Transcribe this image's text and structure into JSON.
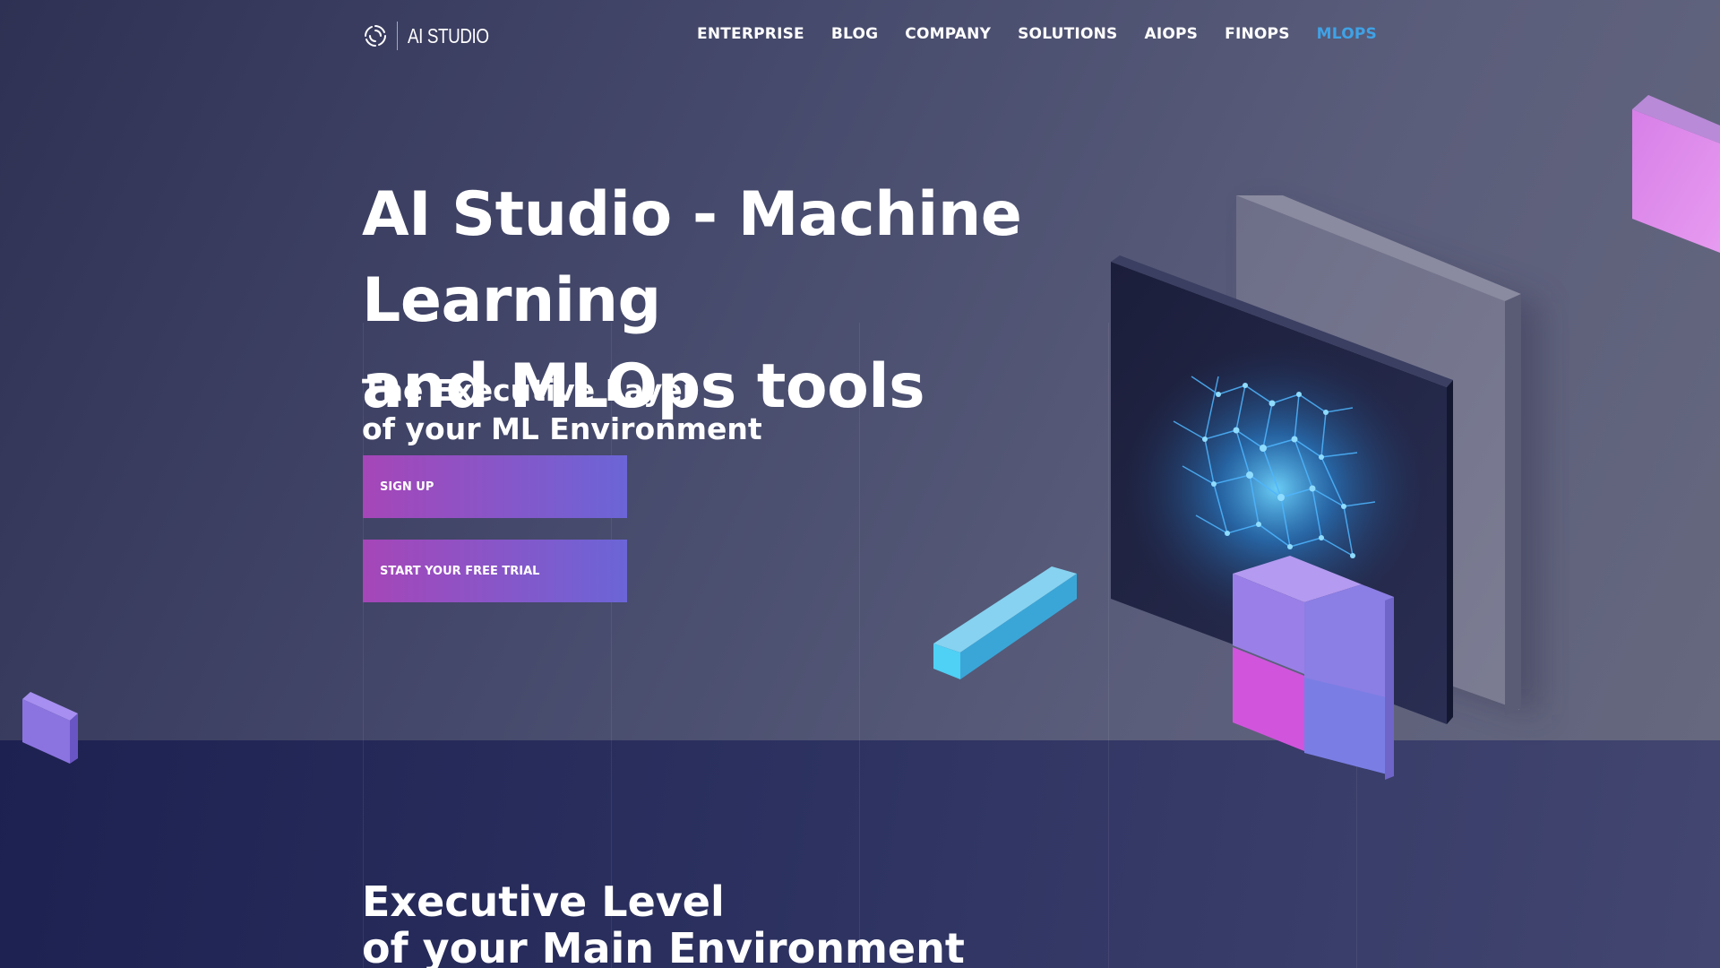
{
  "brand": {
    "name": "AI STUDIO",
    "logo_icon": "swirl-logo-icon"
  },
  "nav": {
    "items": [
      {
        "label": "ENTERPRISE",
        "active": false
      },
      {
        "label": "BLOG",
        "active": false
      },
      {
        "label": "COMPANY",
        "active": false
      },
      {
        "label": "SOLUTIONS",
        "active": false
      },
      {
        "label": "AIOPS",
        "active": false
      },
      {
        "label": "FINOPS",
        "active": false
      },
      {
        "label": "MLOPS",
        "active": true
      }
    ]
  },
  "hero": {
    "title_line1": "AI Studio - Machine Learning",
    "title_line2": "and MLOps tools",
    "subtitle_line1": "The Executive Layer",
    "subtitle_line2": "of your ML Environment",
    "signup_label": "SIGN UP",
    "trial_label": "START YOUR FREE TRIAL"
  },
  "section": {
    "title_line1": "Executive Level",
    "title_line2": "of your Main Environment"
  },
  "colors": {
    "accent_active": "#3fa2e6",
    "button_gradient_start": "#a646b8",
    "button_gradient_end": "#6b65d7",
    "text": "#ffffff"
  }
}
